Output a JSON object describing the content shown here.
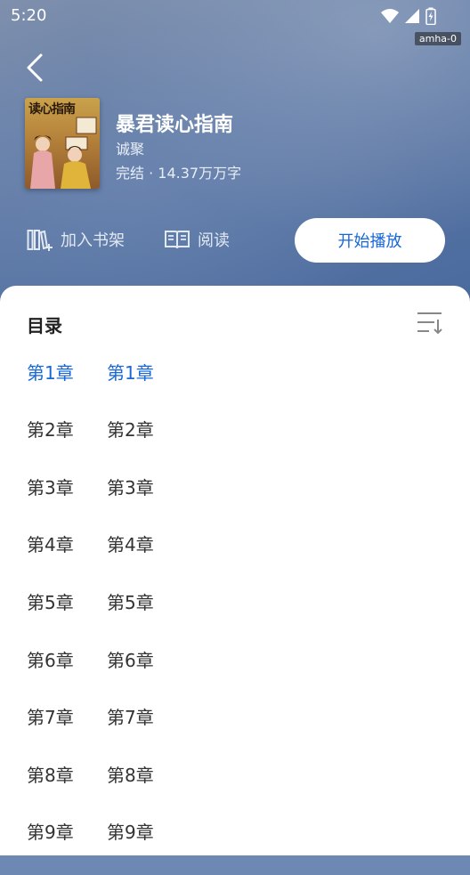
{
  "status": {
    "time": "5:20",
    "badge": "amha-0"
  },
  "book": {
    "cover_text": "读心指南",
    "title": "暴君读心指南",
    "author": "诚聚",
    "meta": "完结 · 14.37万万字"
  },
  "actions": {
    "add_shelf_label": "加入书架",
    "read_label": "阅读",
    "play_label": "开始播放"
  },
  "toc": {
    "heading": "目录",
    "chapters": [
      {
        "num": "第1章",
        "title": "第1章"
      },
      {
        "num": "第2章",
        "title": "第2章"
      },
      {
        "num": "第3章",
        "title": "第3章"
      },
      {
        "num": "第4章",
        "title": "第4章"
      },
      {
        "num": "第5章",
        "title": "第5章"
      },
      {
        "num": "第6章",
        "title": "第6章"
      },
      {
        "num": "第7章",
        "title": "第7章"
      },
      {
        "num": "第8章",
        "title": "第8章"
      },
      {
        "num": "第9章",
        "title": "第9章"
      }
    ]
  },
  "colors": {
    "accent": "#1767d6",
    "hero": "#5f7aa6"
  }
}
